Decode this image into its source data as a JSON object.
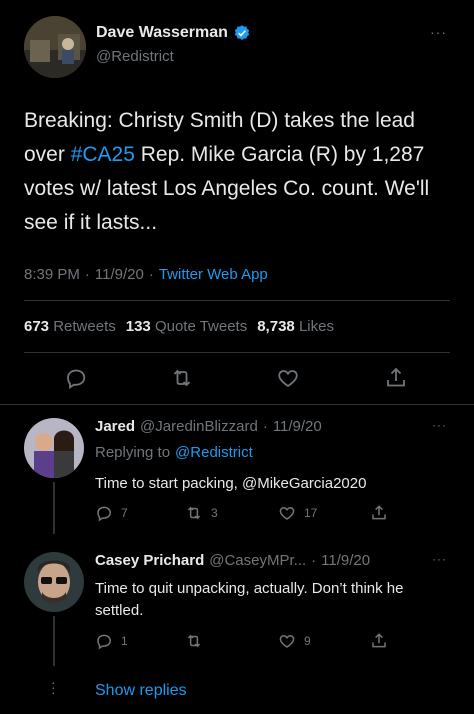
{
  "main_tweet": {
    "author_name": "Dave Wasserman",
    "handle": "@Redistrict",
    "text_before_tag": "Breaking: Christy Smith (D) takes the lead over ",
    "hashtag": "#CA25",
    "text_after_tag": " Rep. Mike Garcia (R) by 1,287 votes w/ latest Los Angeles Co. count. We'll see if it lasts...",
    "time": "8:39 PM",
    "date": "11/9/20",
    "source": "Twitter Web App",
    "retweets_count": "673",
    "retweets_label": "Retweets",
    "quotes_count": "133",
    "quotes_label": "Quote Tweets",
    "likes_count": "8,738",
    "likes_label": "Likes",
    "more": "···",
    "separator": "·"
  },
  "replies": [
    {
      "author_name": "Jared",
      "handle": "@JaredinBlizzard",
      "date": "11/9/20",
      "replying_prefix": "Replying to",
      "replying_handle": "@Redistrict",
      "text": "Time to start packing, @MikeGarcia2020",
      "reply_count": "7",
      "retweet_count": "3",
      "like_count": "17",
      "more": "···"
    },
    {
      "author_name": "Casey Prichard",
      "handle": "@CaseyMPr...",
      "date": "11/9/20",
      "text": "Time to quit unpacking, actually. Don’t think he settled.",
      "reply_count": "1",
      "retweet_count": "",
      "like_count": "9",
      "more": "···"
    }
  ],
  "show_replies": "Show replies",
  "colors": {
    "accent": "#1d9bf0",
    "muted": "#71767b",
    "text": "#e7e9ea",
    "divider": "#2f3336"
  }
}
